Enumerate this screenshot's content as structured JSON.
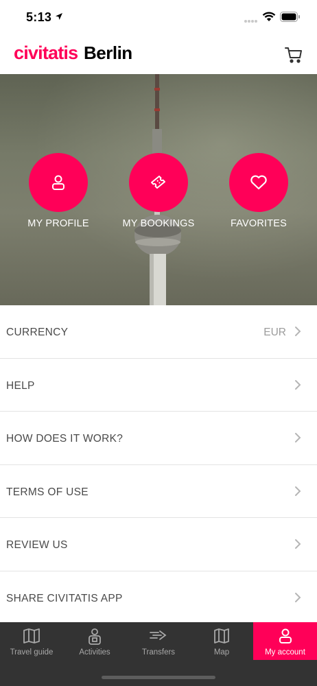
{
  "status_bar": {
    "time": "5:13"
  },
  "header": {
    "brand": "civitatis",
    "city": "Berlin",
    "cart_icon": "cart-icon"
  },
  "hero": {
    "actions": [
      {
        "label": "MY PROFILE",
        "icon": "user-icon"
      },
      {
        "label": "MY BOOKINGS",
        "icon": "ticket-icon"
      },
      {
        "label": "FAVORITES",
        "icon": "heart-icon"
      }
    ]
  },
  "menu": {
    "items": [
      {
        "label": "CURRENCY",
        "value": "EUR"
      },
      {
        "label": "HELP",
        "value": ""
      },
      {
        "label": "HOW DOES IT WORK?",
        "value": ""
      },
      {
        "label": "TERMS OF USE",
        "value": ""
      },
      {
        "label": "REVIEW US",
        "value": ""
      },
      {
        "label": "SHARE CIVITATIS APP",
        "value": ""
      }
    ]
  },
  "tabbar": {
    "tabs": [
      {
        "label": "Travel guide",
        "icon": "guide-map-icon"
      },
      {
        "label": "Activities",
        "icon": "activities-icon"
      },
      {
        "label": "Transfers",
        "icon": "transfers-icon"
      },
      {
        "label": "Map",
        "icon": "map-icon"
      },
      {
        "label": "My account",
        "icon": "user-icon",
        "active": true
      }
    ]
  },
  "colors": {
    "accent": "#ff0058",
    "tabbar_bg": "#333333",
    "text": "#4a4a4a",
    "muted": "#9b9b9b"
  }
}
